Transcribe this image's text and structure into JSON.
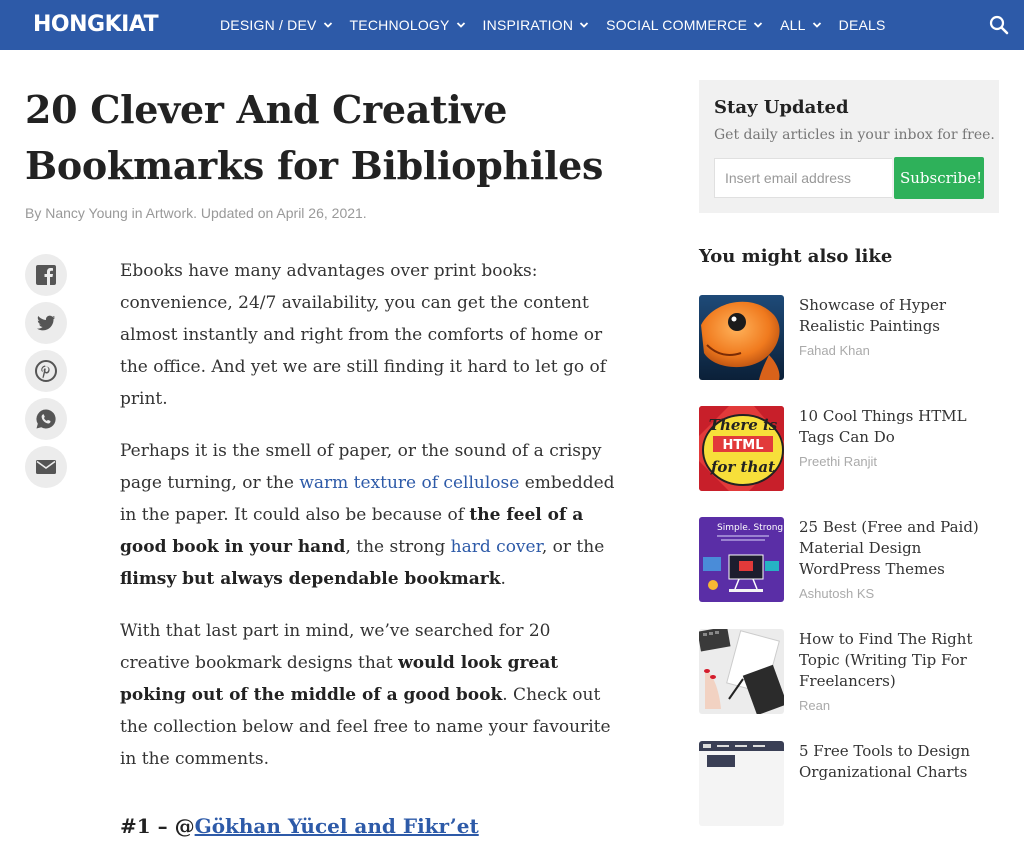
{
  "header": {
    "logo": "HONGKIAT",
    "nav": [
      {
        "label": "DESIGN / DEV",
        "has_dropdown": true
      },
      {
        "label": "TECHNOLOGY",
        "has_dropdown": true
      },
      {
        "label": "INSPIRATION",
        "has_dropdown": true
      },
      {
        "label": "SOCIAL COMMERCE",
        "has_dropdown": true
      },
      {
        "label": "ALL",
        "has_dropdown": true
      },
      {
        "label": "DEALS",
        "has_dropdown": false
      }
    ],
    "search_icon": "search-icon"
  },
  "article": {
    "title": "20 Clever And Creative Bookmarks for Bibliophiles",
    "byline": {
      "by": "By ",
      "author": "Nancy Young",
      "in": " in ",
      "category": "Artwork",
      "updated": ". Updated on April 26, 2021."
    },
    "share": [
      {
        "name": "facebook-icon"
      },
      {
        "name": "twitter-icon"
      },
      {
        "name": "pinterest-icon"
      },
      {
        "name": "whatsapp-icon"
      },
      {
        "name": "email-icon"
      }
    ],
    "p1": "Ebooks have many advantages over print books: convenience, 24/7 availability, you can get the content almost instantly and right from the comforts of home or the office. And yet we are still finding it hard to let go of print.",
    "p2": {
      "t1": "Perhaps it is the smell of paper, or the sound of a crispy page turning, or the ",
      "link1": "warm texture of cellulose",
      "t2": " embedded in the paper. It could also be because of ",
      "b1": "the feel of a good book in your hand",
      "t3": ", the strong ",
      "link2": "hard cover",
      "t4": ", or the ",
      "b2": "flimsy but always dependable bookmark",
      "t5": "."
    },
    "p3": {
      "t1": "With that last part in mind, we’ve searched for 20 creative bookmark designs that ",
      "b1": "would look great poking out of the middle of a good book",
      "t2": ". Check out the collection below and feel free to name your favourite in the comments."
    },
    "h1": {
      "prefix": "#1 – @",
      "link": "Gökhan Yücel and Fikr’et"
    }
  },
  "sidebar": {
    "newsletter": {
      "title": "Stay Updated",
      "subtitle": "Get daily articles in your inbox for free.",
      "placeholder": "Insert email address",
      "button": "Subscribe!"
    },
    "related_heading": "You might also like",
    "related": [
      {
        "title": "Showcase of Hyper Realistic Paintings",
        "author": "Fahad Khan"
      },
      {
        "title": "10 Cool Things HTML Tags Can Do",
        "author": "Preethi Ranjit",
        "thumb_text": [
          "There is",
          "HTML",
          "for that"
        ]
      },
      {
        "title": "25 Best (Free and Paid) Material Design WordPress Themes",
        "author": "Ashutosh KS",
        "thumb_text": [
          "Simple. Strong."
        ]
      },
      {
        "title": "How to Find The Right Topic (Writing Tip For Freelancers)",
        "author": "Rean"
      },
      {
        "title": "5 Free Tools to Design Organizational Charts",
        "author": ""
      }
    ]
  },
  "colors": {
    "nav_bg": "#2d5aa8",
    "link": "#2d5aa8",
    "subscribe": "#2eb15a",
    "newsletter_bg": "#f1f1f1"
  }
}
